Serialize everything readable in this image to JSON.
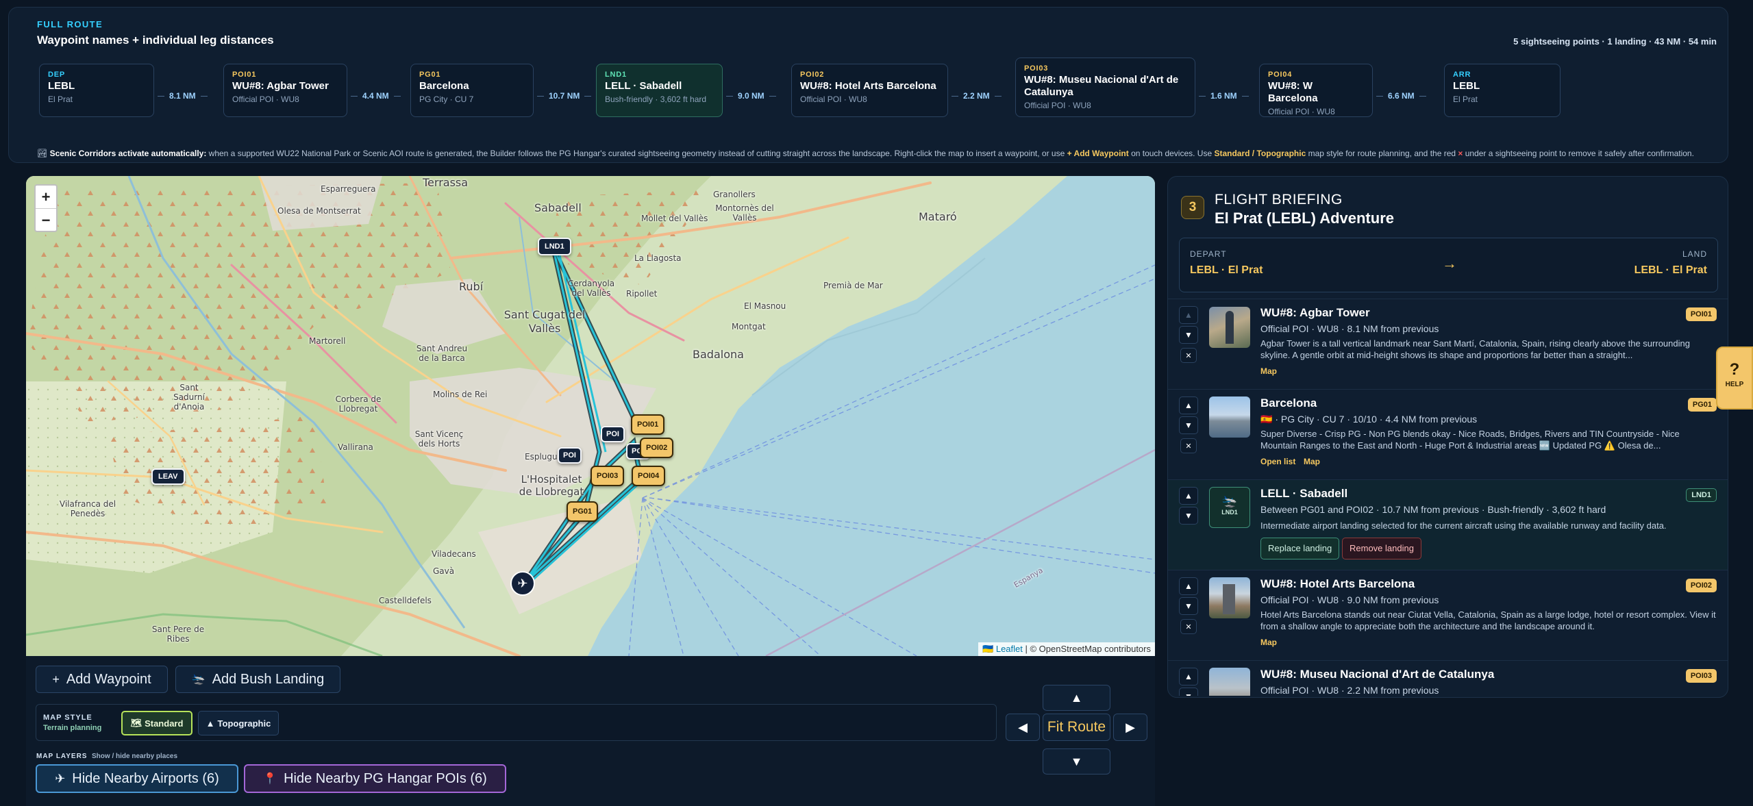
{
  "route": {
    "kicker": "FULL ROUTE",
    "title": "Waypoint names + individual leg distances",
    "summary": "5 sightseeing points · 1 landing · 43 NM · 54 min",
    "waypoints": [
      {
        "tag": "DEP",
        "name": "LEBL",
        "sub": "El Prat",
        "tag_color": "#35d0ff"
      },
      {
        "tag": "POI01",
        "name": "WU#8: Agbar Tower",
        "sub": "Official POI · WU8",
        "tag_color": "#f6c85f"
      },
      {
        "tag": "PG01",
        "name": "Barcelona",
        "sub": "PG City · CU 7",
        "tag_color": "#f6c85f"
      },
      {
        "tag": "LND1",
        "name": "LELL · Sabadell",
        "sub": "Bush-friendly · 3,602 ft hard",
        "tag_color": "#5fe3b5"
      },
      {
        "tag": "POI02",
        "name": "WU#8: Hotel Arts Barcelona",
        "sub": "Official POI · WU8",
        "tag_color": "#f6c85f"
      },
      {
        "tag": "POI03",
        "name": "WU#8: Museu Nacional d'Art de Catalunya",
        "sub": "Official POI · WU8",
        "tag_color": "#f6c85f"
      },
      {
        "tag": "POI04",
        "name": "WU#8: W Barcelona",
        "sub": "Official POI · WU8",
        "tag_color": "#f6c85f"
      },
      {
        "tag": "ARR",
        "name": "LEBL",
        "sub": "El Prat",
        "tag_color": "#35d0ff"
      }
    ],
    "legs": [
      "8.1 NM",
      "4.4 NM",
      "10.7 NM",
      "9.0 NM",
      "2.2 NM",
      "1.6 NM",
      "6.6 NM"
    ],
    "scenic": {
      "lead": "Scenic Corridors activate automatically:",
      "text1": " when a supported WU22 National Park or Scenic AOI route is generated, the Builder follows the PG Hangar's curated sightseeing geometry instead of cutting straight across the landscape. Right-click the map to insert a waypoint, or use ",
      "hl1": "+ Add Waypoint",
      "text2": " on touch devices. Use ",
      "hl2": "Standard / Topographic",
      "text3": " map style for route planning, and the red ",
      "x": "×",
      "text4": " under a sightseeing point to remove it safely after confirmation."
    }
  },
  "map": {
    "zoom_in": "+",
    "zoom_out": "−",
    "attribution_link": "Leaflet",
    "attribution_rest": " | © OpenStreetMap contributors",
    "places": [
      {
        "text": "Terrassa",
        "size": "big"
      },
      {
        "text": "Sabadell",
        "size": "big"
      },
      {
        "text": "Mataró",
        "size": "big"
      },
      {
        "text": "Esparreguera",
        "size": "small"
      },
      {
        "text": "Olesa de Montserrat",
        "size": "small"
      },
      {
        "text": "Rubí",
        "size": "big"
      },
      {
        "text": "Sant Cugat del Vallès",
        "size": "big"
      },
      {
        "text": "Badalona",
        "size": "big"
      },
      {
        "text": "Martorell",
        "size": "small"
      },
      {
        "text": "Sant Andreu de la Barca",
        "size": "small"
      },
      {
        "text": "Molins de Rei",
        "size": "small"
      },
      {
        "text": "Sant Sadurní d'Anoia",
        "size": "small"
      },
      {
        "text": "L'Hospitalet de Llobregat",
        "size": "big"
      },
      {
        "text": "Vilafranca del Penedès",
        "size": "small"
      },
      {
        "text": "Viladecans",
        "size": "small"
      },
      {
        "text": "Gavà",
        "size": "small"
      },
      {
        "text": "Castelldefels",
        "size": "small"
      },
      {
        "text": "Sant Pere de Ribes",
        "size": "small"
      },
      {
        "text": "Montgat",
        "size": "small"
      },
      {
        "text": "El Masnou",
        "size": "small"
      },
      {
        "text": "Premià de Mar",
        "size": "small"
      },
      {
        "text": "Mollet del Vallès",
        "size": "small"
      },
      {
        "text": "Granollers",
        "size": "small"
      },
      {
        "text": "Cerdanyola del Vallès",
        "size": "small"
      },
      {
        "text": "La Llagosta",
        "size": "small"
      },
      {
        "text": "Ripollet",
        "size": "small"
      },
      {
        "text": "Vallirana",
        "size": "small"
      },
      {
        "text": "Corbera de Llobregat",
        "size": "small"
      },
      {
        "text": "Sant Vicenç dels Horts",
        "size": "small"
      },
      {
        "text": "Esplugues",
        "size": "small"
      },
      {
        "text": "Montornès del Vallès",
        "size": "small"
      },
      {
        "text": "Espanya",
        "size": "small"
      }
    ],
    "markers": {
      "lnd1": "LND1",
      "leav": "LEAV",
      "poi": "POI",
      "poi_b": "POI",
      "poi_c": "POI",
      "poi01": "POI01",
      "poi02": "POI02",
      "poi03": "POI03",
      "poi04": "POI04",
      "pg01": "PG01",
      "plane": "✈"
    }
  },
  "controls": {
    "add_waypoint": "Add Waypoint",
    "add_waypoint_icon": "+",
    "add_bush": "Add Bush Landing",
    "add_bush_icon": "🛬",
    "style_label": "MAP STYLE",
    "style_sub": "Terrain planning",
    "style_standard": "Standard",
    "style_standard_icon": "🗺",
    "style_topo": "Topographic",
    "style_topo_icon": "▲",
    "fit_route": "Fit Route",
    "up": "▲",
    "down": "▼",
    "left": "◀",
    "right": "▶",
    "layers_label": "MAP LAYERS",
    "layers_sub": "Show / hide nearby places",
    "hide_airports": "Hide Nearby Airports (6)",
    "hide_airports_icon": "✈",
    "hide_pois": "Hide Nearby PG Hangar POIs (6)",
    "hide_pois_icon": "📍"
  },
  "briefing": {
    "number": "3",
    "kicker": "FLIGHT BRIEFING",
    "title": "El Prat (LEBL) Adventure",
    "depart_label": "DEPART",
    "depart_value": "LEBL · El Prat",
    "land_label": "LAND",
    "land_value": "LEBL · El Prat",
    "arrow": "→",
    "entries": [
      {
        "title": "WU#8: Agbar Tower",
        "badge": "POI01",
        "meta": "Official POI · WU8 · 8.1 NM from previous",
        "desc": "Agbar Tower is a tall vertical landmark near Sant Martí, Catalonia, Spain, rising clearly above the surrounding skyline. A gentle orbit at mid-height shows its shape and proportions far better than a straight...",
        "link1": "Map"
      },
      {
        "title": "Barcelona",
        "badge": "PG01",
        "meta": "🇪🇸 · PG City · CU 7 · 10/10 · 4.4 NM from previous",
        "desc": "Super Diverse - Crisp PG - Non PG blends okay - Nice Roads, Bridges, Rivers and TIN Countryside - Nice Mountain Ranges to the East and North - Huge Port & Industrial areas 🆕 Updated PG ⚠️ Olesa de...",
        "link1": "Open list",
        "link2": "Map"
      },
      {
        "title": "LELL · Sabadell",
        "badge": "LND1",
        "meta": "Between PG01 and POI02 · 10.7 NM from previous · Bush-friendly · 3,602 ft hard",
        "desc": "Intermediate airport landing selected for the current aircraft using the available runway and facility data.",
        "replace": "Replace landing",
        "remove": "Remove landing",
        "icon_label": "LND1"
      },
      {
        "title": "WU#8: Hotel Arts Barcelona",
        "badge": "POI02",
        "meta": "Official POI · WU8 · 9.0 NM from previous",
        "desc": "Hotel Arts Barcelona stands out near Ciutat Vella, Catalonia, Spain as a large lodge, hotel or resort complex. View it from a shallow angle to appreciate both the architecture and the landscape around it.",
        "link1": "Map"
      },
      {
        "title": "WU#8: Museu Nacional d'Art de Catalunya",
        "badge": "POI03",
        "meta": "Official POI · WU8 · 2.2 NM from previous"
      }
    ],
    "up": "▲",
    "down": "▼",
    "remove": "✕"
  },
  "help": {
    "icon": "?",
    "label": "HELP"
  },
  "colors": {
    "accent_gold": "#f3c66a",
    "accent_cyan": "#35d0ff",
    "route_line": "#27c3d8",
    "sea": "#aad3df"
  }
}
